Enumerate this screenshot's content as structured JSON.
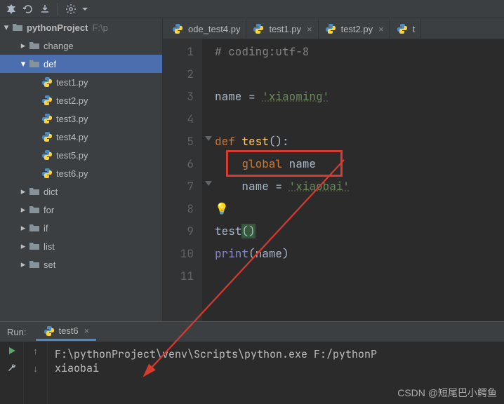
{
  "toolbar": {
    "icons": [
      "build-icon",
      "reload-icon",
      "download-icon",
      "sep",
      "gear-icon"
    ]
  },
  "tree": {
    "root": {
      "label": "pythonProject",
      "hint": "F:\\p",
      "expanded": true
    },
    "items": [
      {
        "label": "change",
        "type": "folder",
        "expanded": false,
        "depth": 1
      },
      {
        "label": "def",
        "type": "folder",
        "expanded": true,
        "depth": 1,
        "selected": true
      },
      {
        "label": "test1.py",
        "type": "py",
        "depth": 2
      },
      {
        "label": "test2.py",
        "type": "py",
        "depth": 2
      },
      {
        "label": "test3.py",
        "type": "py",
        "depth": 2
      },
      {
        "label": "test4.py",
        "type": "py",
        "depth": 2
      },
      {
        "label": "test5.py",
        "type": "py",
        "depth": 2
      },
      {
        "label": "test6.py",
        "type": "py",
        "depth": 2
      },
      {
        "label": "dict",
        "type": "folder",
        "expanded": false,
        "depth": 1
      },
      {
        "label": "for",
        "type": "folder",
        "expanded": false,
        "depth": 1
      },
      {
        "label": "if",
        "type": "folder",
        "expanded": false,
        "depth": 1
      },
      {
        "label": "list",
        "type": "folder",
        "expanded": false,
        "depth": 1
      },
      {
        "label": "set",
        "type": "folder",
        "expanded": false,
        "depth": 1
      }
    ]
  },
  "tabs": [
    {
      "label": "ode_test4.py",
      "partial": true
    },
    {
      "label": "test1.py"
    },
    {
      "label": "test2.py"
    },
    {
      "label": "t",
      "partial": true
    }
  ],
  "gutter": [
    "1",
    "2",
    "3",
    "4",
    "5",
    "6",
    "7",
    "8",
    "9",
    "10",
    "11"
  ],
  "code": {
    "l1_comment": "# coding:utf-8",
    "l3_name": "name",
    "l3_eq": " = ",
    "l3_str": "'xiaoming'",
    "l5_def": "def ",
    "l5_fn": "test",
    "l5_paren": "():",
    "l6_indent": "    ",
    "l6_global": "global",
    "l6_sp": " ",
    "l6_name": "name",
    "l7_indent": "    ",
    "l7_name": "name",
    "l7_eq": " = ",
    "l7_str": "'xiaobai'",
    "l9_call": "test",
    "l9_paren": "()",
    "l10_print": "print",
    "l10_open": "(",
    "l10_arg": "name",
    "l10_close": ")"
  },
  "run": {
    "title": "Run:",
    "tab": "test6",
    "cmd": "F:\\pythonProject\\venv\\Scripts\\python.exe F:/pythonP",
    "out": "xiaobai"
  },
  "watermark": "CSDN @短尾巴小鳄鱼"
}
